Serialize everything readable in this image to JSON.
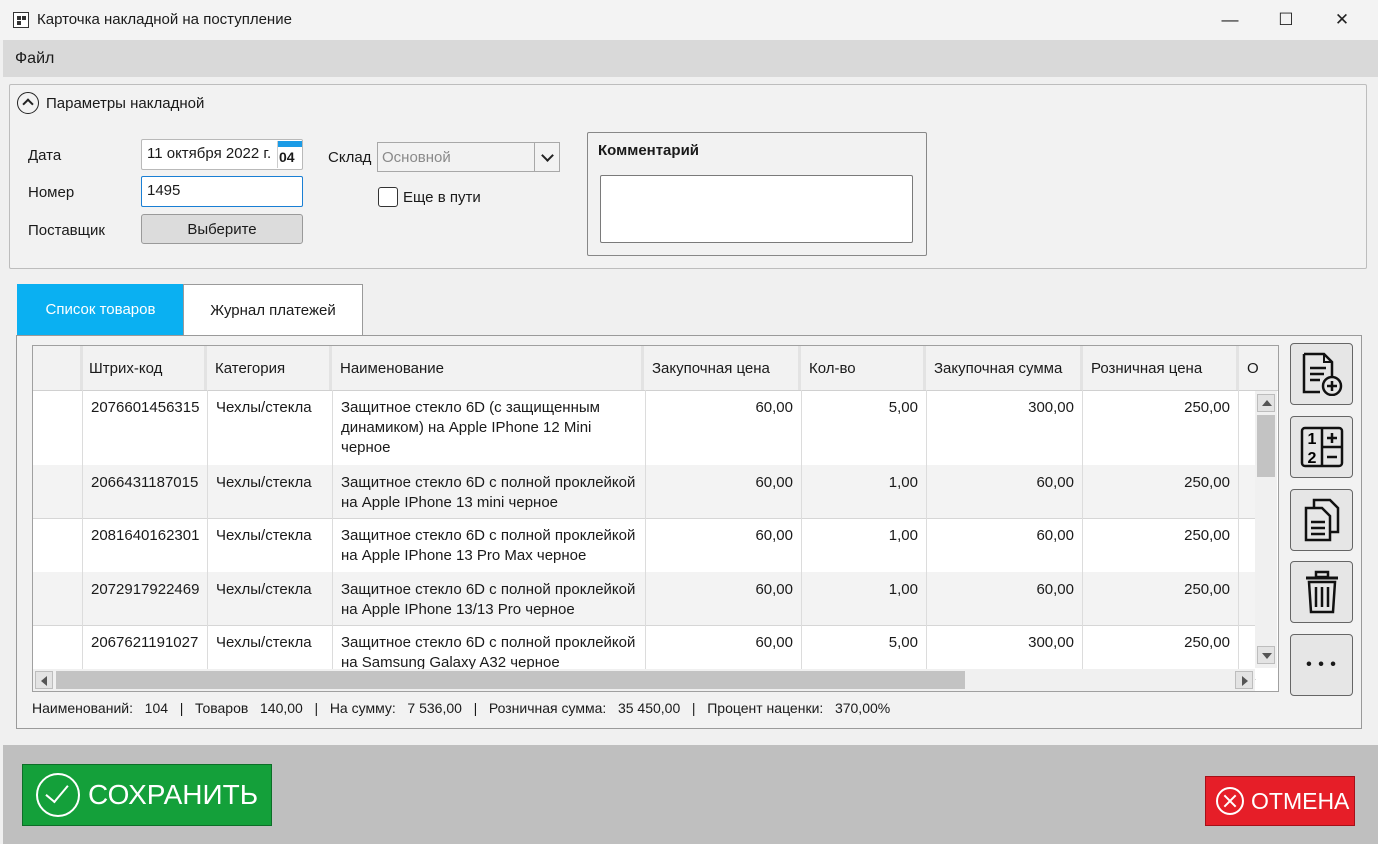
{
  "window": {
    "title": "Карточка накладной на поступление",
    "minimize": "—",
    "maximize": "☐",
    "close": "✕"
  },
  "menu": {
    "file": "Файл"
  },
  "params": {
    "header": "Параметры накладной",
    "date_label": "Дата",
    "date_value": "11 октября 2022 г.",
    "calendar_day": "04",
    "number_label": "Номер",
    "number_value": "1495",
    "supplier_label": "Поставщик",
    "supplier_button": "Выберите",
    "warehouse_label": "Склад",
    "warehouse_value": "Основной",
    "in_transit_label": "Еще в пути",
    "in_transit_checked": false,
    "comment_title": "Комментарий",
    "comment_value": ""
  },
  "tabs": [
    {
      "label": "Список товаров",
      "active": true
    },
    {
      "label": "Журнал платежей",
      "active": false
    }
  ],
  "grid": {
    "columns": [
      "Штрих-код",
      "Категория",
      "Наименование",
      "Закупочная цена",
      "Кол-во",
      "Закупочная сумма",
      "Розничная цена",
      "О"
    ],
    "rows": [
      {
        "barcode": "2076601456315",
        "category": "Чехлы/стекла",
        "name": "Защитное стекло 6D (с защищенным динамиком) на Apple IPhone 12 Mini черное",
        "price": "60,00",
        "qty": "5,00",
        "sum": "300,00",
        "retail": "250,00"
      },
      {
        "barcode": "2066431187015",
        "category": "Чехлы/стекла",
        "name": "Защитное стекло 6D с полной проклейкой на Apple IPhone 13 mini черное",
        "price": "60,00",
        "qty": "1,00",
        "sum": "60,00",
        "retail": "250,00"
      },
      {
        "barcode": "2081640162301",
        "category": "Чехлы/стекла",
        "name": "Защитное стекло 6D с полной проклейкой на Apple IPhone 13 Pro Max черное",
        "price": "60,00",
        "qty": "1,00",
        "sum": "60,00",
        "retail": "250,00"
      },
      {
        "barcode": "2072917922469",
        "category": "Чехлы/стекла",
        "name": "Защитное стекло 6D с полной проклейкой на Apple IPhone 13/13 Pro черное",
        "price": "60,00",
        "qty": "1,00",
        "sum": "60,00",
        "retail": "250,00"
      },
      {
        "barcode": "2067621191027",
        "category": "Чехлы/стекла",
        "name": "Защитное стекло 6D с полной проклейкой на Samsung Galaxy A32 черное",
        "price": "60,00",
        "qty": "5,00",
        "sum": "300,00",
        "retail": "250,00"
      }
    ]
  },
  "tools": {
    "add_icon": "document-add-icon",
    "calc_icon": "calculator-icon",
    "copy_icon": "copy-documents-icon",
    "delete_icon": "trash-icon",
    "more_label": "• • •"
  },
  "summary": {
    "names_label": "Наименований:",
    "names_value": "104",
    "goods_label": "Товаров",
    "goods_value": "140,00",
    "sum_label": "На сумму:",
    "sum_value": "7 536,00",
    "retail_label": "Розничная сумма:",
    "retail_value": "35 450,00",
    "markup_label": "Процент наценки:",
    "markup_value": "370,00%",
    "separator": "|"
  },
  "footer": {
    "save_label": "СОХРАНИТЬ",
    "cancel_label": "ОТМЕНА"
  },
  "colors": {
    "accent": "#0ab0f2",
    "save": "#14a03a",
    "cancel": "#e61e28"
  }
}
